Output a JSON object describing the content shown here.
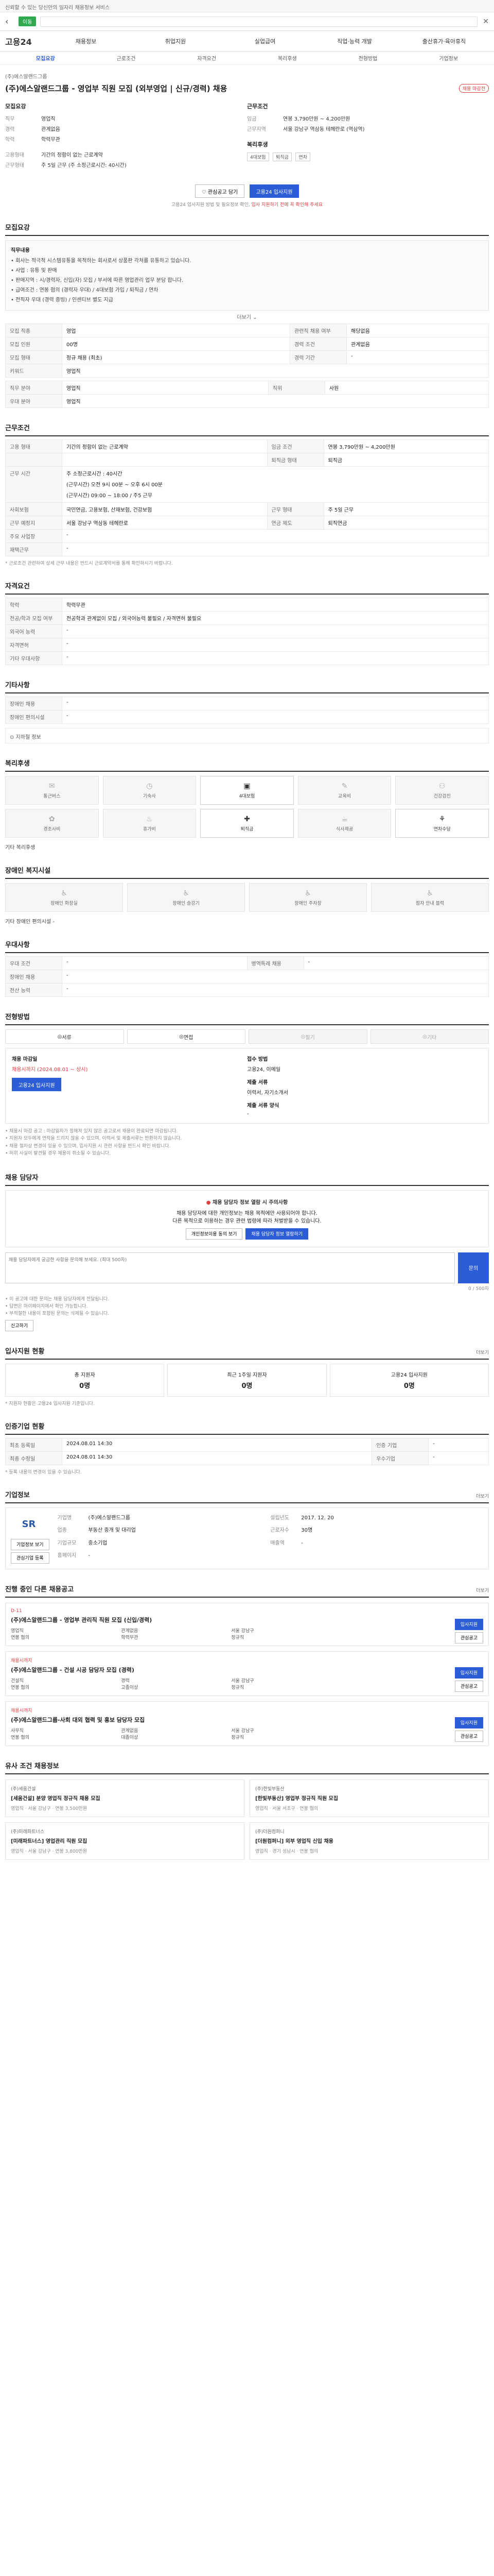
{
  "notice": "신뢰할 수 있는 당신만의 일자리 채용정보 서비스",
  "topbar": {
    "chip": "이동"
  },
  "gnb": {
    "logo": "고용24",
    "items": [
      "채용정보",
      "취업지원",
      "실업급여",
      "직업·능력 개발",
      "출산휴가·육아휴직"
    ]
  },
  "subtabs": [
    "모집요강",
    "근로조건",
    "자격요건",
    "복리후생",
    "전형방법",
    "기업정보"
  ],
  "job": {
    "company": "(주)에스알랜드그룹",
    "title": "(주)에스알랜드그룹 - 영업부 직원 모집 (외부영업 | 신규/경력) 채용",
    "badge": "채용 마감전"
  },
  "summary": {
    "recruit_head": "모집요강",
    "condition_head": "근무조건",
    "items_left": [
      {
        "k": "직무",
        "v": "영업직"
      },
      {
        "k": "경력",
        "v": "관계없음"
      },
      {
        "k": "학력",
        "v": "학력무관"
      }
    ],
    "items_right": [
      {
        "k": "임금",
        "v": "연봉 3,790만원 ~ 4,200만원"
      },
      {
        "k": "근무지역",
        "v": "서울 강남구 역삼동 테헤란로 (역삼역)"
      }
    ],
    "items_left2": [
      {
        "k": "고용형태",
        "v": "기간의 정함이 없는 근로계약"
      },
      {
        "k": "근무형태",
        "v": "주 5일 근무 (주 소정근로시간: 40시간)"
      }
    ],
    "benefit_head": "복리후생",
    "benefit_tags": [
      "4대보험",
      "퇴직금",
      "연차"
    ]
  },
  "apply": {
    "scrap_label": "관심공고 담기",
    "apply_label": "고용24 입사지원",
    "note": "고용24 입사지원 방법 및 필요정보 확인,",
    "note_link": "입사 지원하기 전에 꼭 확인해 주세요"
  },
  "recruit_section": {
    "title": "모집요강",
    "box_head": "직무내용",
    "lines": [
      "• 회사는 적극적 시스템유통을 목적하는 회사로서 상품판 각처를 유통하고 있습니다.",
      "• 사업 : 유통 및 판매",
      "• 판매지역 : 시/경력자, 신입(자) 모집 / 부서에 따른 영업관리 업무 분담 합니다.",
      "• 급여조건 : 연봉 협의 (경력자 우대) / 4대보험 가입 / 퇴직금 / 연차",
      "• 전직자 우대 (경력 증빙) / 인센티브 별도 지급"
    ],
    "more": "더보기",
    "rows": [
      {
        "k1": "모집 직종",
        "v1": "영업",
        "k2": "관련직 채용 여부",
        "v2": "해당없음"
      },
      {
        "k1": "모집 인원",
        "v1": "00명",
        "k2": "경력 조건",
        "v2": "관계없음"
      },
      {
        "k1": "모집 형태",
        "v1": "정규 채용 (최초)",
        "k2": "경력 기간",
        "v2": "-"
      },
      {
        "k1": "키워드",
        "v1": "영업직",
        "k2": "",
        "v2": ""
      }
    ],
    "rows2": [
      {
        "k1": "직무 분야",
        "v1": "영업직",
        "k2": "직위",
        "v2": "사원"
      },
      {
        "k1": "우대 분야",
        "v1": "영업직",
        "k2": "",
        "v2": ""
      }
    ]
  },
  "work_section": {
    "title": "근무조건",
    "rows": [
      {
        "k1": "고용 형태",
        "v1": "기간의 정함이 없는 근로계약",
        "k2": "임금 조건",
        "v2": "연봉 3,790만원 ~ 4,200만원"
      },
      {
        "k1": "",
        "v1": "",
        "k2": "퇴직금 형태",
        "v2": "퇴직금"
      },
      {
        "k1": "근무 시간",
        "v1": "주 소정근로시간 : 40시간",
        "k2": "",
        "v2": ""
      },
      {
        "k1": "",
        "v1": "",
        "k2": "",
        "v2": ""
      },
      {
        "k1": "",
        "v1": "",
        "k2": "",
        "v2": ""
      },
      {
        "k1": "사회보험",
        "v1": "국민연금, 고용보험, 산재보험, 건강보험",
        "k2": "근무 형태",
        "v2": "주 5일 근무"
      },
      {
        "k1": "근무 예정지",
        "v1": "서울 강남구 역삼동 테헤란로",
        "k2": "연금 제도",
        "v2": "퇴직연금"
      },
      {
        "k1": "주요 사업장",
        "v1": "-",
        "k2": "",
        "v2": ""
      }
    ],
    "hours_text": "(근무시간) 오전 9시 00분 ~ 오후 6시 00분",
    "hours_text2": "(근무시간) 09:00 ~ 18:00 / 주5 근무",
    "workplace_detail": "서울특별시 강남구 역삼동",
    "extra_row_label": "재택근무",
    "extra_row_value": "-",
    "footnote": "* 근로조건 관련하여 상세 근무 내용은 반드시 근로계약서를 통해 확인하시기 바랍니다."
  },
  "qual_section": {
    "title": "자격요건",
    "rows": [
      {
        "k": "학력",
        "v": "학력무관"
      },
      {
        "k": "전공/학과 모집 여부",
        "v": "전공학과 관계없이 모집 / 외국어능력 불필요 / 자격면허 불필요"
      },
      {
        "k": "외국어 능력",
        "v": "-"
      },
      {
        "k": "자격면허",
        "v": "-"
      },
      {
        "k": "기타 우대사항",
        "v": "-"
      }
    ]
  },
  "other_section": {
    "title": "기타사항",
    "rows": [
      {
        "k": "장애인 채용",
        "v": "-"
      },
      {
        "k": "장애인 편의시설",
        "v": "-"
      }
    ],
    "map_label": "지하철 정보"
  },
  "welfare_section": {
    "title": "복리후생",
    "cells": [
      {
        "icon": "✉",
        "label": "통근버스",
        "hl": false
      },
      {
        "icon": "◷",
        "label": "기숙사",
        "hl": false
      },
      {
        "icon": "▣",
        "label": "4대보험",
        "hl": true
      },
      {
        "icon": "✎",
        "label": "교육비",
        "hl": false
      },
      {
        "icon": "⚇",
        "label": "건강검진",
        "hl": false
      },
      {
        "icon": "✿",
        "label": "경조사비",
        "hl": false
      },
      {
        "icon": "♨",
        "label": "휴가비",
        "hl": false
      },
      {
        "icon": "✚",
        "label": "퇴직금",
        "hl": true
      },
      {
        "icon": "☕",
        "label": "식사제공",
        "hl": false
      },
      {
        "icon": "⚘",
        "label": "연차수당",
        "hl": true
      }
    ],
    "cat_line": "기타 복리후생"
  },
  "cert_section": {
    "title": "장애인 복지시설",
    "cells": [
      {
        "icon": "♿",
        "label": "장애인 화장실"
      },
      {
        "icon": "♿",
        "label": "장애인 승강기"
      },
      {
        "icon": "♿",
        "label": "장애인 주차장"
      },
      {
        "icon": "♿",
        "label": "점자 안내 블럭"
      }
    ],
    "extra": "기타 장애인 편의시설",
    "extra_v": "-"
  },
  "etc_section": {
    "title": "우대사항",
    "rows": [
      {
        "k1": "우대 조건",
        "v1": "-",
        "k2": "병역특례 채용",
        "v2": "-"
      },
      {
        "k1": "장애인 채용",
        "v1": "-",
        "k2": "",
        "v2": ""
      },
      {
        "k1": "전산 능력",
        "v1": "-",
        "k2": "",
        "v2": ""
      }
    ]
  },
  "method_section": {
    "title": "전형방법",
    "methods": [
      {
        "label": "서류",
        "dim": false
      },
      {
        "label": "면접",
        "dim": false
      },
      {
        "label": "필기",
        "dim": true
      },
      {
        "label": "기타",
        "dim": true
      }
    ],
    "deadline_label": "채용 마감일",
    "deadline": "채용시까지 (2024.08.01 ~ 상시)",
    "method_label": "접수 방법",
    "method": "고용24, 이메일",
    "docs_label": "제출 서류",
    "docs": "이력서, 자기소개서",
    "apply_btn": "고용24 입사지원",
    "form_label": "제출 서류 양식",
    "form": "-",
    "bullets": [
      "• 채용시 마감 공고 : 마감일자가 정해져 있지 않은 공고로서 채용이 완료되면 마감됩니다.",
      "• 지원자 모두에게 연락을 드리지 않을 수 있으며, 이력서 및 제출서류는 반환하지 않습니다.",
      "• 채용 절차상 변경이 있을 수 있으며, 입사지원 시 관련 사항을 반드시 확인 바랍니다.",
      "• 허위 사실이 발견될 경우 채용이 취소될 수 있습니다."
    ]
  },
  "contact_section": {
    "title": "채용 담당자",
    "warn": "채용 담당자 정보 열람 시 주의사항",
    "desc": "채용 담당자에 대한 개인정보는 채용 목적에만 사용되어야 합니다.",
    "desc2": "다른 목적으로 이용하는 경우 관련 법령에 따라 처벌받을 수 있습니다.",
    "btn1": "개인정보이용 동의 보기",
    "btn2": "채용 담당자 정보 열람하기",
    "qa_placeholder": "채용 담당자에게 궁금한 사항을 문의해 보세요. (최대 500자)",
    "qa_counter": "0 / 500자",
    "qa_submit": "문의",
    "bullets": [
      "• 이 공고에 대한 문의는 채용 담당자에게 전달됩니다.",
      "• 답변은 마이페이지에서 확인 가능합니다.",
      "• 부적절한 내용이 포함된 문의는 삭제될 수 있습니다."
    ],
    "report_label": "신고하기"
  },
  "stats_section": {
    "title": "입사지원 현황",
    "more": "더보기",
    "stats": [
      {
        "label": "총 지원자",
        "value": "0명"
      },
      {
        "label": "최근 1주일 지원자",
        "value": "0명"
      },
      {
        "label": "고용24 입사지원",
        "value": "0명"
      }
    ],
    "note": "* 지원자 현황은 고용24 입사지원 기준입니다."
  },
  "history_section": {
    "title": "인증기업 현황",
    "rows": [
      {
        "k1": "최초 등록일",
        "v1": "2024.08.01 14:30",
        "k2": "인증 기업",
        "v2": "-"
      },
      {
        "k1": "최종 수정일",
        "v1": "2024.08.01 14:30",
        "k2": "우수기업",
        "v2": "-"
      }
    ],
    "note": "* 등록 내용의 변경이 있을 수 있습니다."
  },
  "company_section": {
    "title": "기업정보",
    "more": "더보기",
    "logo_text": "SR",
    "name_label": "기업명",
    "name": "(주)에스알랜드그룹",
    "industry_label": "업종",
    "industry": "부동산 중개 및 대리업",
    "size_label": "기업규모",
    "size": "중소기업",
    "founded_label": "설립년도",
    "founded": "2017. 12. 20",
    "employees_label": "근로자수",
    "employees": "30명",
    "sales_label": "매출액",
    "sales": "-",
    "homepage_label": "홈페이지",
    "homepage": "-",
    "btn1": "기업정보 보기",
    "btn2": "관심기업 등록"
  },
  "ongoing_section": {
    "title": "진행 중인 다른 채용공고",
    "more": "더보기",
    "cards": [
      {
        "red": "D-11",
        "title": "(주)에스알랜드그룹 - 영업부 관리직 직원 모집 (신입/경력)",
        "meta": [
          "영업직",
          "관계없음",
          "서울 강남구",
          "연봉 협의",
          "학력무관",
          "정규직"
        ],
        "btn1": "입사지원",
        "btn2": "관심공고"
      },
      {
        "red": "채용시까지",
        "title": "(주)에스알랜드그룹 - 건설 시공 담당자 모집 (경력)",
        "meta": [
          "건설직",
          "경력",
          "서울 강남구",
          "연봉 협의",
          "고졸이상",
          "정규직"
        ],
        "btn1": "입사지원",
        "btn2": "관심공고"
      },
      {
        "red": "채용시까지",
        "title": "(주)에스알랜드그룹-사회 대외 협력 및 홍보 담당자 모집",
        "meta": [
          "사무직",
          "관계없음",
          "서울 강남구",
          "연봉 협의",
          "대졸이상",
          "정규직"
        ],
        "btn1": "입사지원",
        "btn2": "관심공고"
      }
    ]
  },
  "related_section": {
    "title": "유사 조건 채용정보",
    "cards": [
      {
        "co": "(주)세움건설",
        "title": "[세움건설] 분양 영업직 정규직 채용 모집",
        "meta": "영업직 · 서울 강남구 · 연봉 3,500만원"
      },
      {
        "co": "(주)한빛부동산",
        "title": "[한빛부동산] 영업부 정규직 직원 모집",
        "meta": "영업직 · 서울 서초구 · 연봉 협의"
      },
      {
        "co": "(주)미래파트너스",
        "title": "[미래파트너스] 영업관리 직원 모집",
        "meta": "영업직 · 서울 강남구 · 연봉 3,800만원"
      },
      {
        "co": "(주)더원컴퍼니",
        "title": "[더원컴퍼니] 외부 영업직 신입 채용",
        "meta": "영업직 · 경기 성남시 · 연봉 협의"
      }
    ]
  }
}
